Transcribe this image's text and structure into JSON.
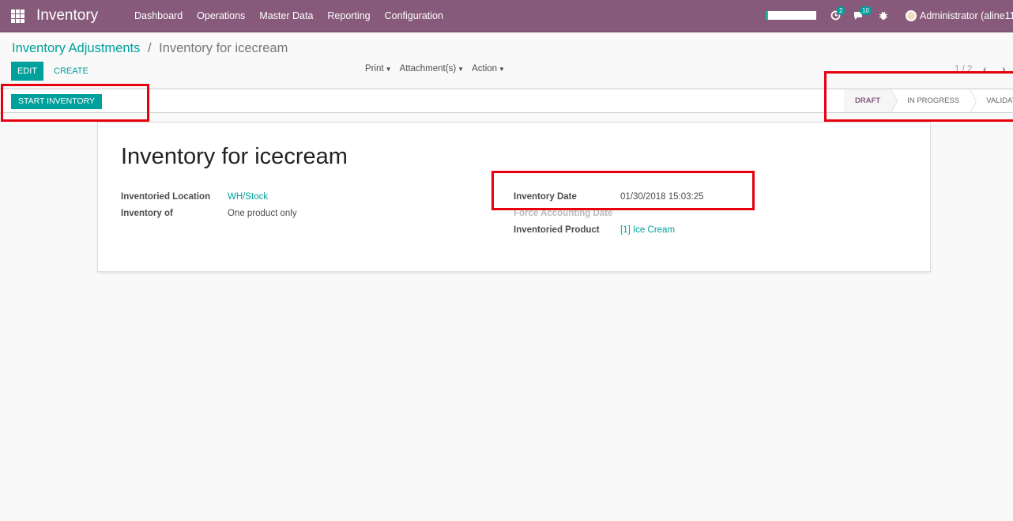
{
  "navbar": {
    "app_title": "Inventory",
    "menu": [
      "Dashboard",
      "Operations",
      "Master Data",
      "Reporting",
      "Configuration"
    ],
    "activity_count": "2",
    "message_count": "10",
    "user_label": "Administrator (aline11"
  },
  "breadcrumb": {
    "parent": "Inventory Adjustments",
    "separator": "/",
    "current": "Inventory for icecream"
  },
  "buttons": {
    "edit": "EDIT",
    "create": "CREATE",
    "start_inventory": "START INVENTORY"
  },
  "sidebar": {
    "print": "Print",
    "attachments": "Attachment(s)",
    "action": "Action"
  },
  "pager": {
    "value": "1 / 2"
  },
  "status": {
    "stages": [
      "DRAFT",
      "IN PROGRESS",
      "VALIDATED"
    ],
    "active": "DRAFT"
  },
  "form": {
    "title": "Inventory for icecream",
    "left_fields": [
      {
        "label": "Inventoried Location",
        "value": "WH/Stock"
      },
      {
        "label": "Inventory of",
        "value": "One product only"
      }
    ],
    "right_fields": [
      {
        "label": "Inventory Date",
        "value": "01/30/2018 15:03:25"
      },
      {
        "label": "Force Accounting Date",
        "value": ""
      },
      {
        "label": "Inventoried Product",
        "value": "[1] Ice Cream"
      }
    ]
  },
  "colors": {
    "brand": "#875a7b",
    "accent": "#00a09d",
    "annotation": "#e6000e"
  }
}
